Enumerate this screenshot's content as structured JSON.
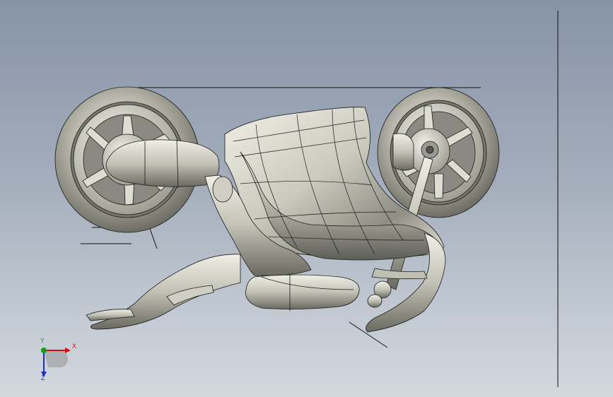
{
  "viewport": {
    "background_top": "#8794a8",
    "background_bottom": "#d3d8de",
    "model_color": "#d9d9cc",
    "edge_color": "#1a1a1a"
  },
  "triad": {
    "x_label": "X",
    "y_label": "Y",
    "z_label": "Z",
    "x_color": "#d01010",
    "y_color": "#1a9a1a",
    "z_color": "#2030c0"
  }
}
